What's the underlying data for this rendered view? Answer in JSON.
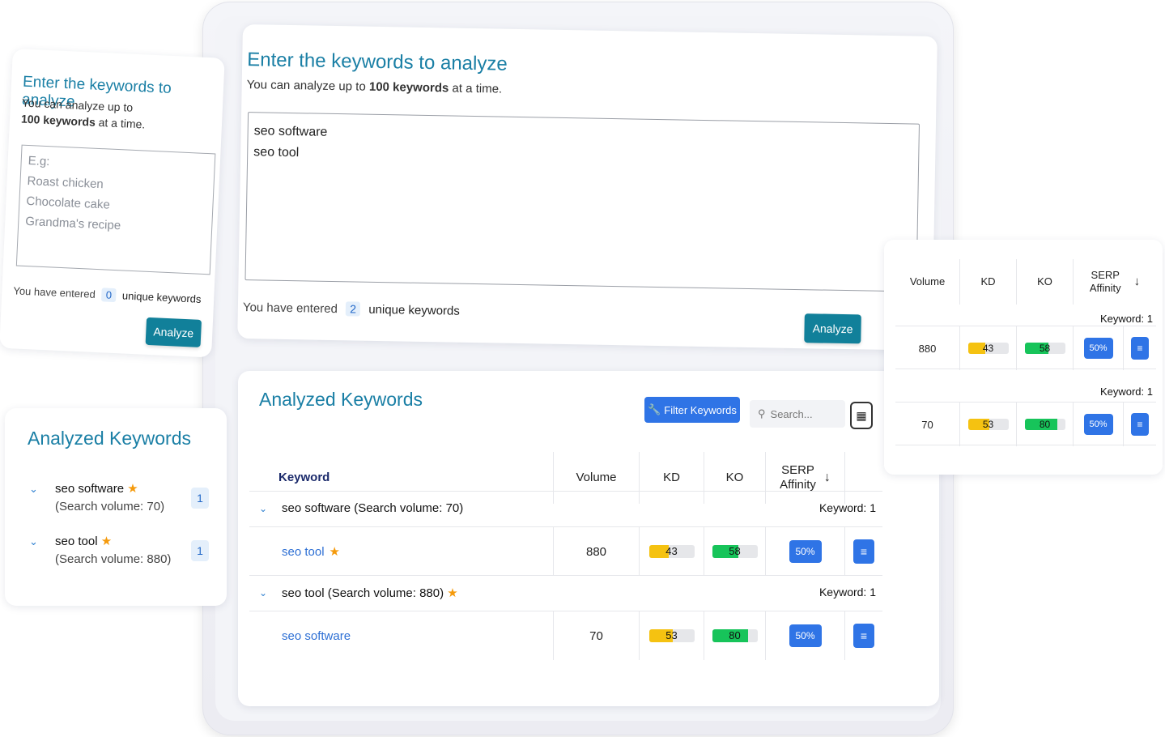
{
  "input_panel": {
    "title": "Enter the keywords to analyze",
    "subtitle_prefix": "You can analyze up to",
    "subtitle_strong": "100 keywords",
    "subtitle_suffix": "at a time.",
    "textarea_lines": [
      "seo software",
      "seo tool"
    ],
    "entered_prefix": "You have entered",
    "entered_count": "2",
    "entered_suffix": "unique keywords",
    "analyze_label": "Analyze"
  },
  "left_input_panel": {
    "title": "Enter the keywords to analyze",
    "subtitle_prefix": "You can analyze up to",
    "subtitle_strong": "100 keywords",
    "subtitle_suffix": "at a time.",
    "placeholder_lines": [
      "E.g:",
      "Roast chicken",
      "Chocolate cake",
      "Grandma's recipe"
    ],
    "entered_prefix": "You have entered",
    "entered_count": "0",
    "entered_suffix": "unique keywords",
    "analyze_label": "Analyze"
  },
  "left_analyzed": {
    "title": "Analyzed Keywords",
    "items": [
      {
        "name": "seo software",
        "volume": "(Search volume: 70)",
        "count": "1"
      },
      {
        "name": "seo tool",
        "volume": "(Search volume: 880)",
        "count": "1"
      }
    ]
  },
  "analyzed": {
    "title": "Analyzed Keywords",
    "filter_label": "Filter Keywords",
    "search_placeholder": "Search...",
    "columns": {
      "keyword": "Keyword",
      "volume": "Volume",
      "kd": "KD",
      "ko": "KO",
      "serp_line1": "SERP",
      "serp_line2": "Affinity"
    },
    "groups": [
      {
        "label": "seo software (Search volume: 70)",
        "keyword_count": "Keyword: 1",
        "row": {
          "keyword": "seo tool",
          "volume": "880",
          "kd": 43,
          "ko": 58,
          "affinity": "50%"
        }
      },
      {
        "label": "seo tool (Search volume: 880)",
        "keyword_count": "Keyword: 1",
        "row": {
          "keyword": "seo software",
          "volume": "70",
          "kd": 53,
          "ko": 80,
          "affinity": "50%"
        }
      }
    ]
  },
  "right_table": {
    "columns": {
      "volume": "Volume",
      "kd": "KD",
      "ko": "KO",
      "serp_line1": "SERP",
      "serp_line2": "Affinity"
    },
    "rows": [
      {
        "keyword_count": "Keyword: 1",
        "volume": "880",
        "kd": 43,
        "ko": 58,
        "affinity": "50%"
      },
      {
        "keyword_count": "Keyword: 1",
        "volume": "70",
        "kd": 53,
        "ko": 80,
        "affinity": "50%"
      }
    ]
  },
  "colors": {
    "teal_heading": "#1a7fa5",
    "analyze_button": "#11809a",
    "primary_blue": "#2f74e6",
    "kd_yellow": "#f5c211",
    "ko_green": "#17c45a",
    "star": "#f59a0c"
  },
  "icons": {
    "chevron": "chevron-down-icon",
    "star": "star-icon",
    "filter": "wrench-icon",
    "search": "search-icon",
    "export": "document-export-icon",
    "sort": "arrow-down-icon",
    "menu": "list-icon"
  }
}
